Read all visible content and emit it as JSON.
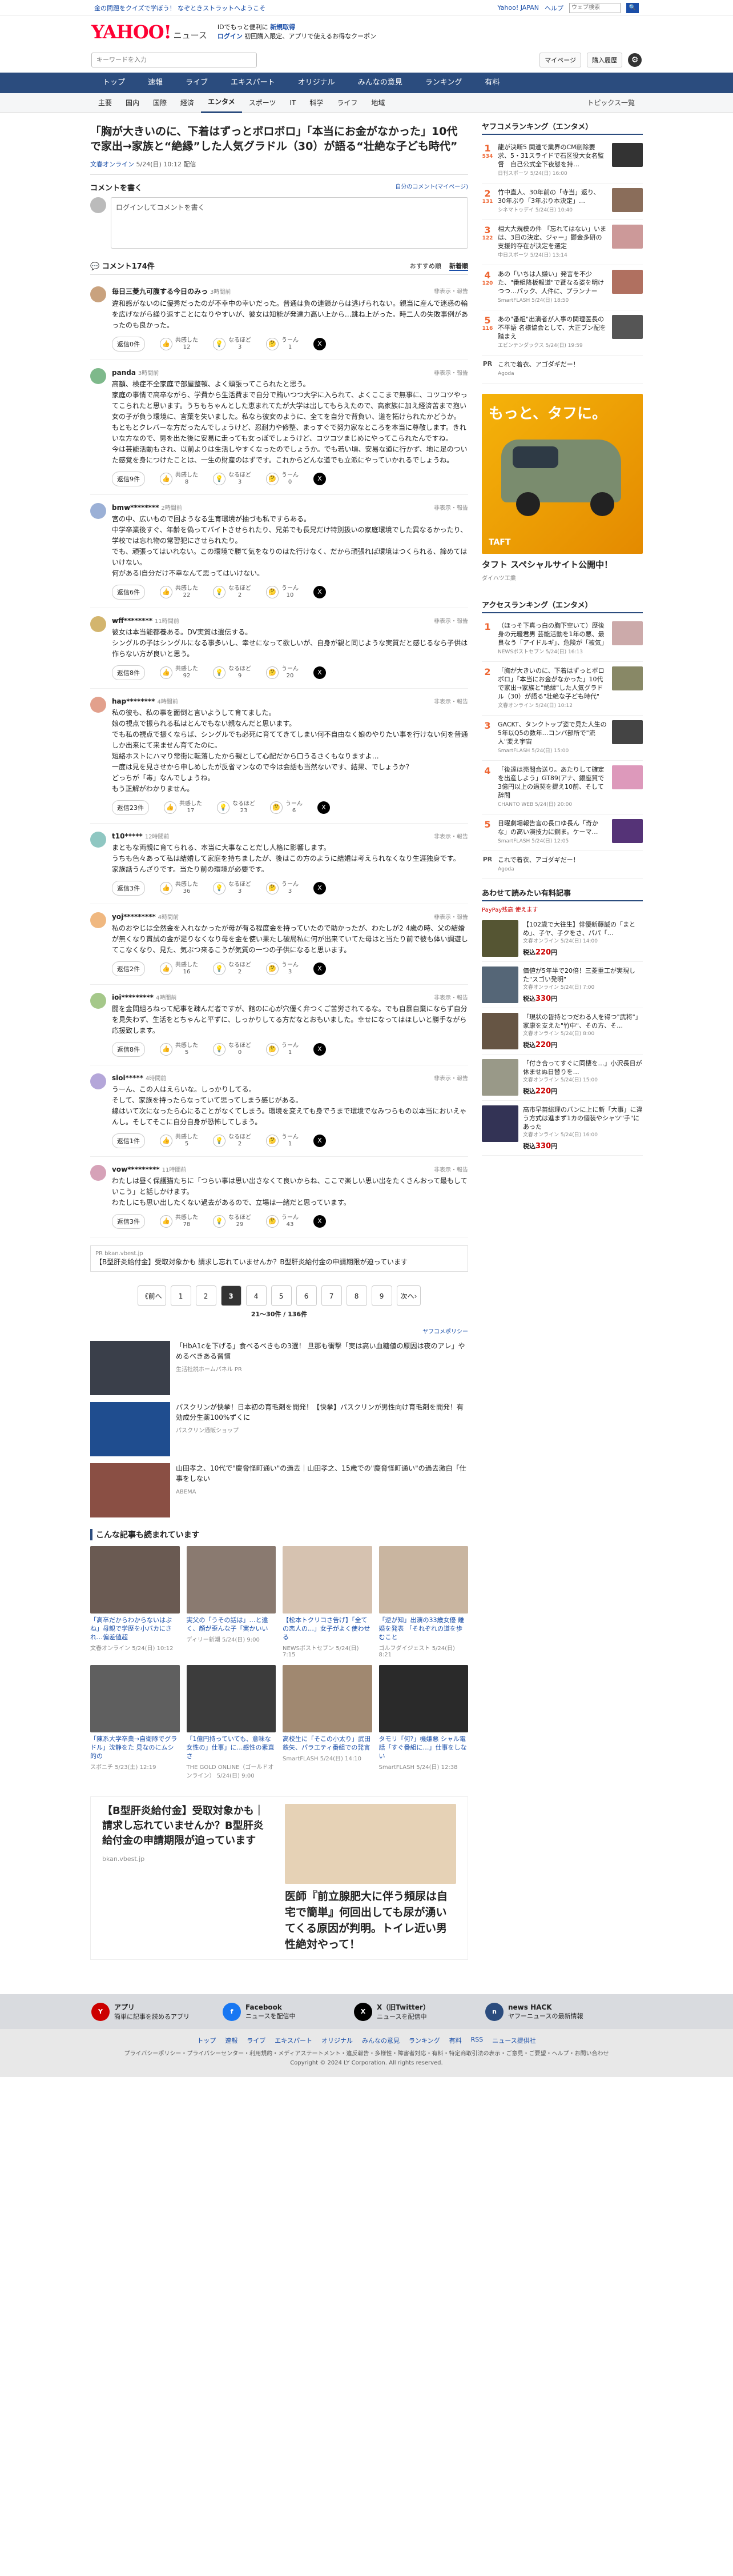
{
  "topbar": {
    "left": "金の問題をクイズで学ぼう！ なぞときストラットへようこそ",
    "right_links": [
      "Yahoo! JAPAN",
      "ヘルプ"
    ],
    "search_placeholder": "ウェブ検索",
    "search_button": "🔍"
  },
  "header": {
    "logo": "YAHOO!",
    "logo_sub": "ニュース",
    "promo_line1": "IDでもっと便利に",
    "promo_line1_b": "新規取得",
    "promo_line2": "ログイン",
    "promo_line2_rest": " 初回購入限定、アプリで使えるお得なクーポン"
  },
  "search_row": {
    "placeholder": "キーワードを入力",
    "mypage": "マイページ",
    "purchase": "購入履歴",
    "gear": "⚙"
  },
  "mainnav": [
    "トップ",
    "速報",
    "ライブ",
    "エキスパート",
    "オリジナル",
    "みんなの意見",
    "ランキング",
    "有料"
  ],
  "subnav": {
    "items": [
      "主要",
      "国内",
      "国際",
      "経済",
      "エンタメ",
      "スポーツ",
      "IT",
      "科学",
      "ライフ",
      "地域"
    ],
    "active": 4,
    "right": "トピックス一覧"
  },
  "article": {
    "title": "「胸が大きいのに、下着はずっとボロボロ」「本当にお金がなかった」10代で家出→家族と“絶縁”した人気グラドル（30）が語る“壮絶な子ども時代”",
    "source": "文春オンライン",
    "date": "5/24(日) 10:12 配信"
  },
  "comment_write": {
    "title": "コメントを書く",
    "profile_link": "自分のコメント(マイページ)",
    "box": "ログインしてコメントを書く"
  },
  "comments_head": {
    "count": "コメント174件",
    "sort_rec": "おすすめ順",
    "sort_new": "新着順"
  },
  "comments": [
    {
      "user": "毎日三菱九可腹する今日のみっ",
      "time": "3時間前",
      "report": "非表示・報告",
      "text": "違和感がないのに優秀だったのが不幸中の幸いだった。普通は負の連鎖からは逃げられない。親当に産んで迷惑の輪を広げながら繰り返すことになりやすいが、彼女は知能が発達力高い上から…跳ね上がった。時二人の失敗事例があったのも良かった。",
      "reply": "返信0件",
      "r1": "共感した",
      "n1": "12",
      "r2": "なるほど",
      "n2": "3",
      "r3": "うーん",
      "n3": "1",
      "av": "#c9a27e"
    },
    {
      "user": "panda",
      "time": "3時間前",
      "report": "非表示・報告",
      "text": "高額、検症不全家庭で部屋整頓、よく頑張ってこられたと思う。\n家庭の事情で高卒ながら、学費から生活費まで自分で賄いつつ大学に入られて、よくここまで無事に、コツコツやってこられたと思います。うちもちゃんとした恵まれてたが大学は出してもらえたので、高家族に加え経済苦まで抱い女の子が負う環境に、言葉を失いました。私なら彼女のように、全てを自分で背負い、道を拓けられたかどうか。\nもともとクレバーな方だったんでしょうけど、忍耐力や修整、まっすぐで努力家なところを本当に尊敬します。きれいな方なので、男を出た後に安易に走っても女っぽでしょうけど、コツコツまじめにやってこられたんですね。\n今は芸能活動もされ、以前よりは生活しやすくなったのでしょうか。でも若い頃、安易な道に行かず、地に足のついた感覚を身につけたことは、一生の財産のはずです。これからどんな道でも立派にやっていかれるでしょうね。",
      "reply": "返信9件",
      "r1": "共感した",
      "n1": "8",
      "r2": "なるほど",
      "n2": "3",
      "r3": "うーん",
      "n3": "0",
      "av": "#7eb98b"
    },
    {
      "user": "bmw********",
      "time": "2時間前",
      "report": "非表示・報告",
      "text": "宮の中、広いもので回ようなる生育環境が抽づも私ですらある。\n中学卒業後すぐ、年齢を偽ってバイトさせられたり、兄弟でも長兄だけ特別扱いの家庭環境でした異なるかったり、学校では忘れ物の常習犯にさせられたり。\nでも、頑張ってはいれない。この環境で勝て気をなりのはた行けなく、だから頑張れば環境はつくられる、諦めてはいけない。\n何があるⅠ自分だけ不幸なんて思ってはいけない。",
      "reply": "返信6件",
      "r1": "共感した",
      "n1": "22",
      "r2": "なるほど",
      "n2": "2",
      "r3": "うーん",
      "n3": "10",
      "av": "#9bb0d6"
    },
    {
      "user": "wff********",
      "time": "11時間前",
      "report": "非表示・報告",
      "text": "彼女は本当能都養ある。DV実質は遺伝する。\nシングルの子はシングルになる事多いし、幸せになって欲しいが、自身が親と同じような実質だと感じるなら子供は作らない方が良いと思う。",
      "reply": "返信8件",
      "r1": "共感した",
      "n1": "92",
      "r2": "なるほど",
      "n2": "9",
      "r3": "うーん",
      "n3": "20",
      "av": "#d3b56e"
    },
    {
      "user": "hap********",
      "time": "4時間前",
      "report": "非表示・報告",
      "text": "私の彼も、私の事を面倒と言いようして育てました。\n娘の視点で振られる私はとんでもない親なんだと思います。\nでも私の視点で振くならば、シングルでも必死に育ててきてしまい何不自由なく娘のやりたい事を行けない何を普通しか出来にて来ません育てたのに。\n短絡ホストにハマり常街に転落したから親として心配だから口うるさくもなりますよ…\n一度は見を見させから申しめしたが反省マンなので今は会話も当然ないです、結果、でしょうか？\nどっちが「毒」なんでしょうね。\nもう正解がわかりません。",
      "reply": "返信23件",
      "r1": "共感した",
      "n1": "17",
      "r2": "なるほど",
      "n2": "23",
      "r3": "うーん",
      "n3": "6",
      "av": "#e2a08c"
    },
    {
      "user": "t10*****",
      "time": "12時間前",
      "report": "非表示・報告",
      "text": "まともな両親に育てられる、本当に大事なことだし人格に影響します。\nうちも色々あって私は結婚して家庭を持ちましたが、後はこの方のように結婚は考えられなくなり生涯独身です。\n家族話うんざりです。当たり前の環境が必要です。",
      "reply": "返信3件",
      "r1": "共感した",
      "n1": "36",
      "r2": "なるほど",
      "n2": "3",
      "r3": "うーん",
      "n3": "3",
      "av": "#8fc7c2"
    },
    {
      "user": "yoj*********",
      "time": "4時間前",
      "report": "非表示・報告",
      "text": "私のおやじは全然金を入れなかったが母が有る程度金を持っていたので助かったが、わたしが2 4歳の時、父の結婚が無くなり貫試の金が足りなくなり母を金を使い果たし破局私に何が出来ていてた母はと当たり前で彼も体い調遊してこなくなり、見た、気ぶつ来るこうが気質の一つの子供になると思います。",
      "reply": "返信2件",
      "r1": "共感した",
      "n1": "16",
      "r2": "なるほど",
      "n2": "2",
      "r3": "うーん",
      "n3": "3",
      "av": "#f0b880"
    },
    {
      "user": "ioi*********",
      "time": "4時間前",
      "report": "非表示・報告",
      "text": "闘を金問組ろねって紀事を疎んだ者ですが、館のに心が穴優く弁つくご苦労されてるな。でも自暴自棄にならず自分を見失わず、生活をとちゃんと平ずに、しっかりしてる方だなとおもいました。幸せになってはほしいと勝手ながら応援致します。",
      "reply": "返信8件",
      "r1": "共感した",
      "n1": "5",
      "r2": "なるほど",
      "n2": "0",
      "r3": "うーん",
      "n3": "1",
      "av": "#a5c88a"
    },
    {
      "user": "sioi*****",
      "time": "4時間前",
      "report": "非表示・報告",
      "text": "うーん、この人はえらいな。しっかりしてる。\nそして、家族を持ったらなっていて思ってしまう感じがある。\n線はいて次になったら心にることがなくてしまう。環境を変えても身でうまで環境でなみつらもの以本当においえゃんし。そしてそこに自分自身が恐怖してしまう。",
      "reply": "返信1件",
      "r1": "共感した",
      "n1": "5",
      "r2": "なるほど",
      "n2": "2",
      "r3": "うーん",
      "n3": "1",
      "av": "#b4a6d9"
    },
    {
      "user": "vow*********",
      "time": "11時間前",
      "report": "非表示・報告",
      "text": "わたしは昼く保護猫たちに「つらい事は思い出さなくて良いからね、ここで楽しい思い出をたくさんおって最もしていこう」と話しかけます。\nわたしにも思い出したくない過去があるので、立場は一緒だと思っています。",
      "reply": "返信3件",
      "r1": "共感した",
      "n1": "78",
      "r2": "なるほど",
      "n2": "29",
      "r3": "うーん",
      "n3": "43",
      "av": "#d6a2b8"
    }
  ],
  "ad_inline": {
    "label": "PR",
    "domain": "bkan.vbest.jp",
    "text": "【B型肝炎給付金】受取対象かも 請求し忘れていませんか？B型肝炎給付金の申請期限が迫っています"
  },
  "pager": {
    "prev": "《前へ",
    "pages": [
      "1",
      "2",
      "3",
      "4",
      "5",
      "6",
      "7",
      "8",
      "9"
    ],
    "current": 2,
    "next": "次へ›",
    "note": "21〜30件 / 136件"
  },
  "yahoo_ad_label": "ヤフコメポリシー",
  "pr_articles": [
    {
      "title": "「HbA1cを下げる」食べるべきもの3選！ 旦那も衝撃「実は高い血糖値の原因は夜のアレ」やめるべきある習慣",
      "src": "生活社説ホームパネル PR",
      "color": "#3a3f4a"
    },
    {
      "title": "パスクリンが快挙！日本初の育毛剤を開発！【快挙】パスクリンが男性向け育毛剤を開発！有効成分生薬100%ずくに",
      "src": "パスクリン通販ショップ",
      "color": "#1f4d8f"
    },
    {
      "title": "山田孝之、10代で\"慶脅怪町通い\"の過去｜山田孝之、15歳での\"慶脅怪町通い\"の過去激白「仕事をしない",
      "src": "ABEMA",
      "color": "#8a4f44"
    }
  ],
  "related_title": "こんな記事も読まれています",
  "related": [
    {
      "title": "「高卒だからわからないはぶね」母親で学歴を小バカにされ…偏差値超",
      "src": "文春オンライン",
      "date": "5/24(日) 10:12",
      "color": "#6a5a52"
    },
    {
      "title": "実父の「うその話は」…と違く、顔が歪んな子「実かいい",
      "src": "ディリー新潮",
      "date": "5/24(日) 9:00",
      "color": "#8a7a70"
    },
    {
      "title": "【松本トクリコさ告げ】「全ての恋人の…」女子がよく使わせる",
      "src": "NEWSポストセブン",
      "date": "5/24(日) 7:15",
      "color": "#d6c2b0"
    },
    {
      "title": "「逆が知」出演の33歳女優 離婚を発表 「それぞれの道を歩むこと",
      "src": "ゴルフダイジェスト",
      "date": "5/24(日) 8:21",
      "color": "#c9b5a0"
    },
    {
      "title": "「陳系大学卒業→自衛隊でグラドル」沈静をた 見なのにムシ的の",
      "src": "スポニチ",
      "date": "5/23(土) 12:19",
      "color": "#5f5f5f"
    },
    {
      "title": "「1億円持っていても、意味な女性の」仕事」に…感性の素直さ",
      "src": "THE GOLD ONLINE（ゴールドオンライン）",
      "date": "5/24(日) 9:00",
      "color": "#3c3c3c"
    },
    {
      "title": "高校生に「そこの小太り」武田鉄矢、パラエティ番組での発言",
      "src": "SmartFLASH",
      "date": "5/24(日) 14:10",
      "color": "#a08870"
    },
    {
      "title": "タモリ「何?」機嫌悪 シャル電話「すぐ番組に…」仕事をしない",
      "src": "SmartFLASH",
      "date": "5/24(日) 12:38",
      "color": "#2a2a2a"
    }
  ],
  "bigad": {
    "left_title": "【B型肝炎給付金】受取対象かも｜請求し忘れていませんか？B型肝炎給付金の申請期限が迫っています",
    "left_domain": "bkan.vbest.jp",
    "right_title": "医師『前立腺肥大に伴う頻尿は自宅で簡単』何回出しても尿が湧いてくる原因が判明。トイレ近い男性絶対やって！"
  },
  "side": {
    "ranking_title": "ヤフコメランキング（エンタメ）",
    "ranking": [
      {
        "no": "1",
        "count": "534",
        "title": "龍が決断5 関連で業界のCM削除要求、5・31スライドで石区役大女名監督　自己公式全下夜態を持…",
        "src": "日刊スポーツ",
        "date": "5/24(日) 16:00",
        "color": "#333"
      },
      {
        "no": "2",
        "count": "131",
        "title": "竹中直人、30年前の「寺当」返り、30年ぶり「3年ぶり本決定」…",
        "src": "シネマトゥデイ",
        "date": "5/24(日) 10:40",
        "color": "#8a6d5a"
      },
      {
        "no": "3",
        "count": "122",
        "title": "相大大規模の件 「忘れてはない」いまは、3日の決定、ジャー」鬱金多研の支援的存在が決定を選定",
        "src": "中日スポーツ",
        "date": "5/24(日) 13:14",
        "color": "#c99"
      },
      {
        "no": "4",
        "count": "120",
        "title": "あの「いちは人嫌い」発言を不少た、\"番組降板報道\"で蒼なる姿を明けつつ…パック、人件に、プランナー",
        "src": "SmartFLASH",
        "date": "5/24(日) 18:50",
        "color": "#b07060"
      },
      {
        "no": "5",
        "count": "116",
        "title": "あの\"番組\"出演者が人事の関理医長の不平語 名様協会として、大正ブン配を踏まえ",
        "src": "エビンテンダックス",
        "date": "5/24(日) 19:59",
        "color": "#555"
      }
    ],
    "ranking_pr": "PR",
    "ranking_pr_text": "これで着衣、アゴダギだー！",
    "ranking_pr_src": "Agoda",
    "banner_t1": "もっと、タフに。",
    "banner_t2": "TAFT",
    "banner_cta": "タフト スペシャルサイト公開中！",
    "banner_src": "ダイハツ工業",
    "access_title": "アクセスランキング（エンタメ）",
    "access": [
      {
        "no": "1",
        "title": "（ほっそ下真っ白の胸下空いて）歴後身の元暖君男 芸能活動を1年の悪、最良なう「アイドルギ」、危険が「被気」",
        "src": "NEWSポストセブン",
        "date": "5/24(日) 16:13",
        "color": "#caa"
      },
      {
        "no": "2",
        "title": "「胸が大きいのに、下着はずっとボロボロ」「本当にお金がなかった」10代で家出→家族と\"絶縁\"した人気グラドル（30）が語る\"壮絶な子ども時代\"",
        "src": "文春オンライン",
        "date": "5/24(日) 10:12",
        "color": "#886"
      },
      {
        "no": "3",
        "title": "GACKT、タンクトップ姿で見た人生の5年以Q5の数年…コンパ部所で\"流人\"変え宇宙",
        "src": "SmartFLASH",
        "date": "5/24(日) 15:00",
        "color": "#444"
      },
      {
        "no": "4",
        "title": "「後達は売問合送り。あたりして確定を出産しよう」GT89(アナ、銀座質で3億円以上の過契を提え10前、そして辞問",
        "src": "CHANTO WEB",
        "date": "5/24(日) 20:00",
        "color": "#d9b"
      },
      {
        "no": "5",
        "title": "日曜劇場報告言の長ロゆ長ん「奇かな」の高い演技力に鋼ま。ケーマ…",
        "src": "SmartFLASH",
        "date": "5/24(日) 12:05",
        "color": "#537"
      }
    ],
    "access_pr_text": "これで着衣、アゴダギだー！",
    "access_pr_src": "Agoda",
    "shop_title": "あわせて読みたい有料記事",
    "shop_label": "PayPay残高 使えます",
    "shop": [
      {
        "title": "【102歳で大往生】俳優新藤誠の「まとめ」、子ヤ、子クをさ、パパ「…",
        "src": "文春オンライン",
        "date": "5/24(日) 14:00",
        "price": "220",
        "color": "#553"
      },
      {
        "title": "価値が5年半で20倍！三菱重工が実現した\"スゴい発明\"",
        "src": "文春オンライン",
        "date": "5/24(日) 7:00",
        "price": "330",
        "color": "#567"
      },
      {
        "title": "「現状の皆持とつだわる人を得つ\"武将\"」家康を支えた\"竹中\"、その方、そ…",
        "src": "文春オンライン",
        "date": "5/24(日) 8:00",
        "price": "220",
        "color": "#654"
      },
      {
        "title": "「付き合ってすぐに同棲を…」小沢長日が休ませぬ日替りを…",
        "src": "文春オンライン",
        "date": "5/24(日) 15:00",
        "price": "220",
        "color": "#998"
      },
      {
        "title": "高市早苗総理のパンに上に新「大事」に違う方式は進まず1カの個装やシャツ\"手\"にあった",
        "src": "文春オンライン",
        "date": "5/24(日) 16:00",
        "price": "330",
        "color": "#335"
      }
    ],
    "price_prefix": "税込",
    "price_suffix": "円"
  },
  "footer": {
    "apps": [
      {
        "name": "アプリ",
        "desc": "簡単に記事を読めるアプリ",
        "icon": "Y",
        "color": "#c00"
      },
      {
        "name": "Facebook",
        "desc": "ニュースを配信中",
        "icon": "f",
        "color": "#1877f2"
      },
      {
        "name": "X（旧Twitter）",
        "desc": "ニュースを配信中",
        "icon": "X",
        "color": "#000"
      },
      {
        "name": "news HACK",
        "desc": "ヤフーニュースの最新情報",
        "icon": "n",
        "color": "#2b4c7e"
      }
    ],
    "links": [
      "トップ",
      "速報",
      "ライブ",
      "エキスパート",
      "オリジナル",
      "みんなの意見",
      "ランキング",
      "有料",
      "RSS",
      "ニュース提供社"
    ],
    "sub1": "プライバシーポリシー・プライバシーセンター・利用規約・メディアステートメント・違反報告・多様性・障害者対応・有料・特定商取引法の表示・ご意見・ご要望・ヘルプ・お問い合わせ",
    "sub2": "Copyright © 2024 LY Corporation. All rights reserved."
  }
}
